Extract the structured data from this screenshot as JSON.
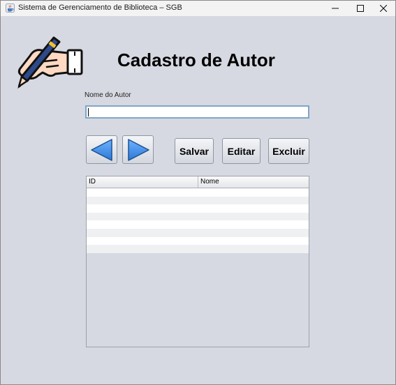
{
  "window": {
    "title": "Sistema de Gerenciamento de Biblioteca – SGB",
    "icon": "java-cup-icon"
  },
  "header": {
    "logo": "hand-writing-pen-icon",
    "title": "Cadastro de Autor"
  },
  "form": {
    "name_label": "Nome do Autor",
    "name_value": ""
  },
  "navigation": {
    "prev_icon": "arrow-left-icon",
    "next_icon": "arrow-right-icon"
  },
  "actions": {
    "save_label": "Salvar",
    "edit_label": "Editar",
    "delete_label": "Excluir"
  },
  "table": {
    "columns": [
      "ID",
      "Nome"
    ],
    "rows": []
  },
  "colors": {
    "background": "#d6d9e1",
    "arrow_blue": "#3f8fe6",
    "focus_border": "#7fa5c8"
  }
}
